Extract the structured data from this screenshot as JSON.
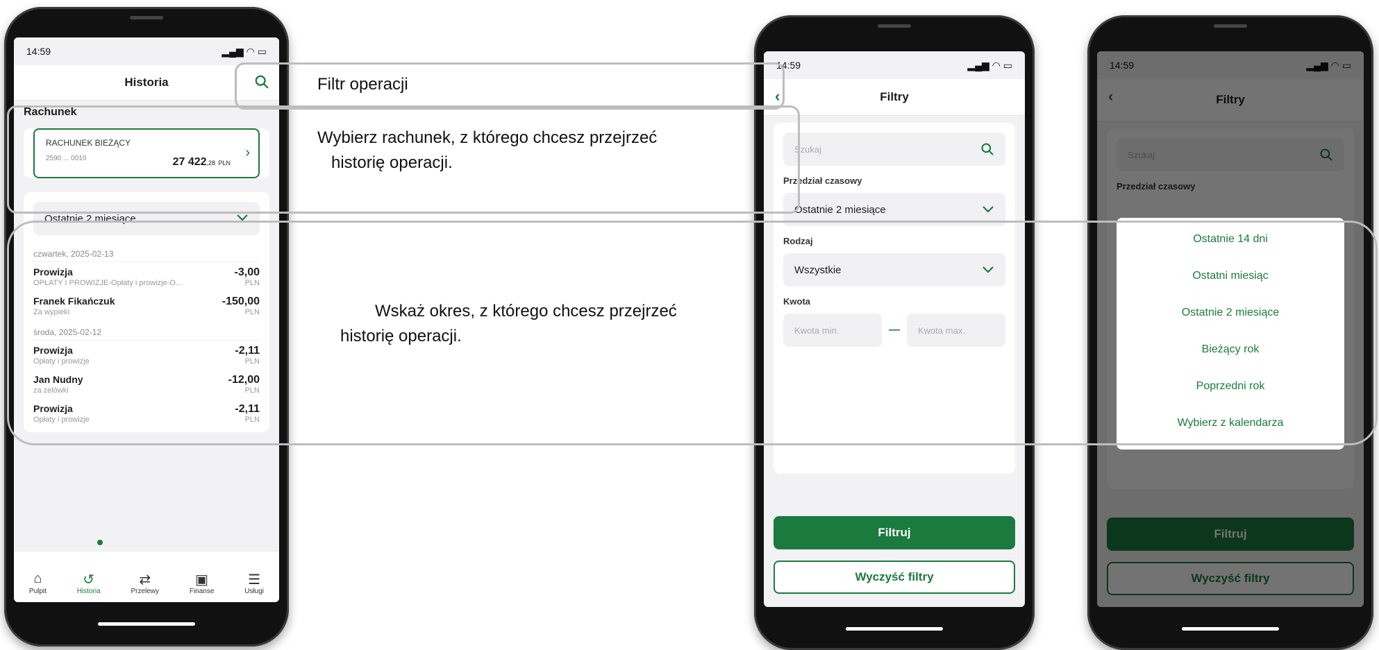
{
  "status_time": "14:59",
  "phone1": {
    "title": "Historia",
    "section": "Rachunek",
    "account": {
      "name": "RACHUNEK BIEŻĄCY",
      "number": "2590 ... 0010",
      "amount_main": "27 422",
      "amount_cents": ",28",
      "currency": "PLN"
    },
    "period": "Ostatnie 2 miesiące",
    "days": [
      {
        "date": "czwartek, 2025-02-13"
      },
      {
        "date": "środa, 2025-02-12"
      }
    ],
    "transactions": [
      {
        "title": "Prowizja",
        "sub": "OPŁATY I PROWIZJE-Opłaty i prowizje-O...",
        "amount": "-3,00",
        "cur": "PLN"
      },
      {
        "title": "Franek Fikańczuk",
        "sub": "Za wypieki",
        "amount": "-150,00",
        "cur": "PLN"
      },
      {
        "title": "Prowizja",
        "sub": "Opłaty i prowizje",
        "amount": "-2,11",
        "cur": "PLN"
      },
      {
        "title": "Jan Nudny",
        "sub": "za zelówki",
        "amount": "-12,00",
        "cur": "PLN"
      },
      {
        "title": "Prowizja",
        "sub": "Opłaty i prowizje",
        "amount": "-2,11",
        "cur": "PLN"
      }
    ],
    "tabs": [
      "Pulpit",
      "Historia",
      "Przelewy",
      "Finanse",
      "Usługi"
    ]
  },
  "annotations": {
    "filter": "Filtr operacji",
    "account_line1": "Wybierz rachunek, z którego chcesz przejrzeć",
    "account_line2": "historię operacji.",
    "period_line1": "Wskaż okres, z którego chcesz przejrzeć",
    "period_line2": "historię operacji."
  },
  "filters": {
    "title": "Filtry",
    "search_placeholder": "Szukaj",
    "period_label": "Przedział czasowy",
    "period_value": "Ostatnie 2 miesiące",
    "type_label": "Rodzaj",
    "type_value": "Wszystkie",
    "amount_label": "Kwota",
    "amount_min": "Kwota min.",
    "amount_max": "Kwota max.",
    "amount_dash": "—",
    "apply": "Filtruj",
    "clear": "Wyczyść filtry"
  },
  "period_options": [
    "Ostatnie 14 dni",
    "Ostatni miesiąc",
    "Ostatnie 2 miesiące",
    "Bieżący rok",
    "Poprzedni rok",
    "Wybierz z kalendarza"
  ],
  "colors": {
    "accent": "#1b7a3e"
  }
}
